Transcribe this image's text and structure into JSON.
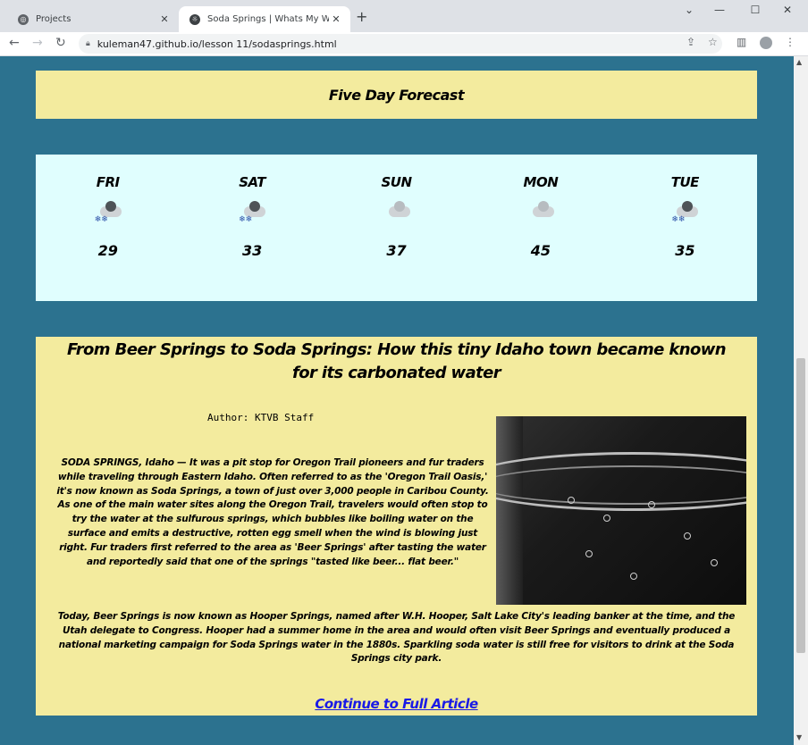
{
  "browser": {
    "tabs": [
      {
        "title": "Projects",
        "active": false
      },
      {
        "title": "Soda Springs | Whats My Weathe",
        "active": true
      }
    ],
    "new_tab": "+",
    "url": "kuleman47.github.io/lesson 11/sodasprings.html"
  },
  "page": {
    "forecast_heading": "Five Day Forecast",
    "days": [
      {
        "name": "FRI",
        "icon": "snow-cloud-icon",
        "temp": "29"
      },
      {
        "name": "SAT",
        "icon": "snow-cloud-icon",
        "temp": "33"
      },
      {
        "name": "SUN",
        "icon": "cloud-icon",
        "temp": "37"
      },
      {
        "name": "MON",
        "icon": "cloud-icon",
        "temp": "45"
      },
      {
        "name": "TUE",
        "icon": "snow-cloud-icon",
        "temp": "35"
      }
    ],
    "article": {
      "title": "From Beer Springs to Soda Springs: How this tiny Idaho town became known for its carbonated water",
      "author": "Author: KTVB Staff",
      "body_part1": "SODA SPRINGS, Idaho — It was a pit stop for Oregon Trail pioneers and fur traders while traveling through Eastern Idaho. Often referred to as the 'Oregon Trail Oasis,' it's now known as Soda Springs, a town of just over 3,000 people in Caribou County. As one of the main water sites along the Oregon Trail, travelers would often stop to try the water at the sulfurous springs, which bubbles like boiling water on the surface and emits a destructive, rotten egg smell when the wind is blowing just right. Fur traders first referred to the area as 'Beer Springs' after tasting the water and reportedly said that one of the springs \"tasted like beer... flat beer.\"",
      "body_part2": "Today, Beer Springs is now known as Hooper Springs, named after W.H. Hooper, Salt Lake City's leading banker at the time, and the Utah delegate to Congress. Hooper had a summer home in the area and would often visit Beer Springs and eventually produced a national marketing campaign for Soda Springs water in the 1880s. Sparkling soda water is still free for visitors to drink at the Soda Springs city park.",
      "link": "Continue to Full Article"
    }
  }
}
